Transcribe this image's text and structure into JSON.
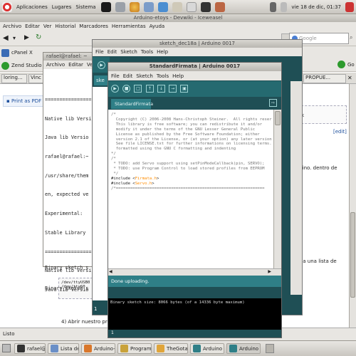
{
  "top_panel": {
    "menus": [
      "Aplicaciones",
      "Lugares",
      "Sistema"
    ],
    "datetime": "vie 18 de dic, 01:37"
  },
  "browser": {
    "title": "Arduino-etoys - Devwiki - Iceweasel",
    "menus": [
      "Archivo",
      "Editar",
      "Ver",
      "Historial",
      "Marcadores",
      "Herramientas",
      "Ayuda"
    ],
    "search_placeholder": "Google",
    "bookmarks": [
      "cPanel X",
      "Zend Studio"
    ],
    "tabs": [
      "loring...",
      "Vinc"
    ],
    "print_link": "Print as PDF",
    "edit_link": "[edit]",
    "propue_tab": "PROPUE...",
    "right_text_1": "tok",
    "right_text_2": "rduino. dentro de",
    "right_text_3": "rt da una lista de",
    "devices": [
      "/dev/ttyUSB0",
      "/dev/ttyS0"
    ],
    "step4": "4) Abrir nuestro pro",
    "status": "Listo"
  },
  "terminal": {
    "title": "rafael@rafael: ~",
    "menus": [
      "Archivo",
      "Editar",
      "Ver"
    ],
    "lines": [
      "================",
      "Native lib Versi",
      "Java lib Versio",
      "rafael@rafael:~",
      "/usr/share/them",
      "en, expected ve",
      "Experimental:",
      "Stable Library",
      "================",
      "Native lib Versi",
      "Java lib Versio"
    ],
    "bottom_lines": [
      "Binary sketch s",
      "Binary sketch s"
    ]
  },
  "sketch_back": {
    "title": "sketch_dec18a | Arduino 0017",
    "menus": [
      "File",
      "Edit",
      "Sketch",
      "Tools",
      "Help"
    ],
    "tab": "ske"
  },
  "arduino": {
    "title": "StandardFirmata | Arduino 0017",
    "menus": [
      "File",
      "Edit",
      "Sketch",
      "Tools",
      "Help"
    ],
    "tab": "StandardFirmata",
    "code_lines": [
      "/*",
      "  Copyright (C) 2006-2008 Hans-Christoph Steiner.  All rights reser",
      "",
      "  This library is free software; you can redistribute it and/or",
      "  modify it under the terms of the GNU Lesser General Public",
      "  License as published by the Free Software Foundation; either",
      "  version 2.1 of the License, or (at your option) any later version",
      "",
      "  See file LICENSE.txt for further informations on licensing terms.",
      "",
      "  formatted using the GNU C formatting and indenting",
      "*/",
      "",
      "",
      "/*",
      " * TODO: add Servo support using setPinModeCallback(pin, SERVO);",
      " * TODO: use Program Control to load stored profiles from EEPROM",
      " */",
      "",
      "#include <Firmata.h>",
      "#include <Servo.h>",
      "",
      "/*=============================================================="
    ],
    "status": "Done uploading.",
    "console": "Binary sketch size: 8066 bytes (of a 14336 byte maximum)",
    "line_number": "1",
    "back_line_number": "1"
  },
  "taskbar": [
    {
      "label": "rafael@r...",
      "icon": "terminal-icon",
      "color": "#333333"
    },
    {
      "label": "Lista de ...",
      "icon": "document-icon",
      "color": "#6a8fc7"
    },
    {
      "label": "Arduino-...",
      "icon": "firefox-icon",
      "color": "#d9772b"
    },
    {
      "label": "Program...",
      "icon": "pencil-icon",
      "color": "#c9a23a"
    },
    {
      "label": "TheGota...",
      "icon": "folder-icon",
      "color": "#e0a53a"
    },
    {
      "label": "Arduino",
      "icon": "arduino-icon",
      "color": "#2f7f87"
    },
    {
      "label": "Arduino",
      "icon": "arduino-icon",
      "color": "#2f7f87"
    }
  ],
  "colors": {
    "arduino_dark": "#1f4f55",
    "arduino_teal": "#2f7f87",
    "arduino_toolbar": "#256a70",
    "highlight": "#ff8c00"
  }
}
